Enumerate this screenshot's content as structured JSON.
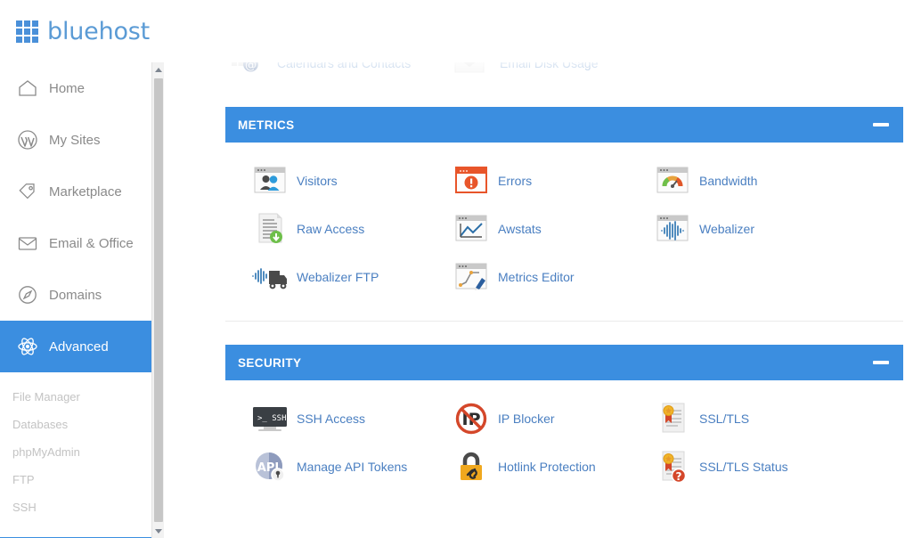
{
  "header": {
    "brand": "bluehost",
    "logo_icon": "grid-3x3-icon",
    "brand_color": "#5b9bd5"
  },
  "sidebar": {
    "items": [
      {
        "label": "Home",
        "icon": "house-icon",
        "active": false
      },
      {
        "label": "My Sites",
        "icon": "wordpress-icon",
        "active": false
      },
      {
        "label": "Marketplace",
        "icon": "tag-icon",
        "active": false
      },
      {
        "label": "Email & Office",
        "icon": "envelope-icon",
        "active": false
      },
      {
        "label": "Domains",
        "icon": "compass-icon",
        "active": false
      },
      {
        "label": "Advanced",
        "icon": "atom-icon",
        "active": true
      }
    ],
    "subitems": [
      {
        "label": "File Manager"
      },
      {
        "label": "Databases"
      },
      {
        "label": "phpMyAdmin"
      },
      {
        "label": "FTP"
      },
      {
        "label": "SSH"
      }
    ],
    "active_bg": "#3b8ee0",
    "scrollbar": {
      "up_icon": "triangle-up-icon",
      "down_icon": "triangle-down-icon"
    }
  },
  "main": {
    "partial_top_row": [
      {
        "label": "Calendars and Contacts",
        "icon": "at-sign-icon"
      },
      {
        "label": "Email Disk Usage",
        "icon": "envelope-icon"
      }
    ],
    "sections": [
      {
        "title": "METRICS",
        "collapse_icon": "minus-icon",
        "tiles": [
          {
            "label": "Visitors",
            "icon": "visitors-icon"
          },
          {
            "label": "Errors",
            "icon": "errors-icon"
          },
          {
            "label": "Bandwidth",
            "icon": "bandwidth-gauge-icon"
          },
          {
            "label": "Raw Access",
            "icon": "raw-access-icon"
          },
          {
            "label": "Awstats",
            "icon": "awstats-chart-icon"
          },
          {
            "label": "Webalizer",
            "icon": "webalizer-waveform-icon"
          },
          {
            "label": "Webalizer FTP",
            "icon": "webalizer-ftp-truck-icon"
          },
          {
            "label": "Metrics Editor",
            "icon": "metrics-editor-icon"
          }
        ]
      },
      {
        "title": "SECURITY",
        "collapse_icon": "minus-icon",
        "tiles": [
          {
            "label": "SSH Access",
            "icon": "terminal-ssh-icon"
          },
          {
            "label": "IP Blocker",
            "icon": "ip-blocker-icon"
          },
          {
            "label": "SSL/TLS",
            "icon": "certificate-icon"
          },
          {
            "label": "Manage API Tokens",
            "icon": "api-token-icon"
          },
          {
            "label": "Hotlink Protection",
            "icon": "padlock-chain-icon"
          },
          {
            "label": "SSL/TLS Status",
            "icon": "certificate-status-icon"
          }
        ]
      }
    ],
    "section_header_color": "#3b8ee0",
    "link_color": "#4a7fc1"
  }
}
